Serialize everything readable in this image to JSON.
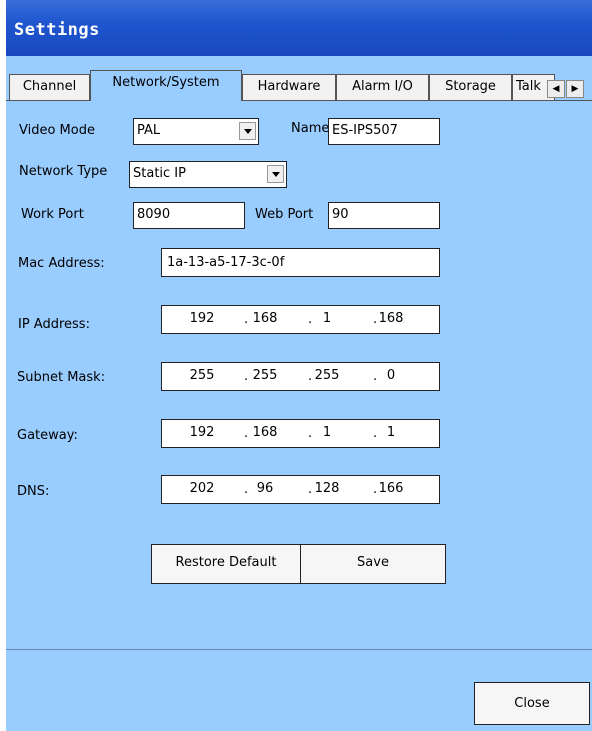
{
  "window": {
    "title": "Settings"
  },
  "tabs": [
    {
      "label": "Channel"
    },
    {
      "label": "Network/System"
    },
    {
      "label": "Hardware"
    },
    {
      "label": "Alarm I/O"
    },
    {
      "label": "Storage"
    },
    {
      "label": "Talk"
    }
  ],
  "form": {
    "video_mode": {
      "label": "Video Mode",
      "value": "PAL"
    },
    "name": {
      "label": "Name",
      "value": "ES-IPS507"
    },
    "network_type": {
      "label": "Network Type",
      "value": "Static IP"
    },
    "work_port": {
      "label": "Work Port",
      "value": "8090"
    },
    "web_port": {
      "label": "Web Port",
      "value": "90"
    },
    "mac_address": {
      "label": "Mac Address:",
      "value": "1a-13-a5-17-3c-0f"
    },
    "ip_address": {
      "label": "IP Address:",
      "octets": [
        "192",
        "168",
        "1",
        "168"
      ]
    },
    "subnet_mask": {
      "label": "Subnet Mask:",
      "octets": [
        "255",
        "255",
        "255",
        "0"
      ]
    },
    "gateway": {
      "label": "Gateway:",
      "octets": [
        "192",
        "168",
        "1",
        "1"
      ]
    },
    "dns": {
      "label": "DNS:",
      "octets": [
        "202",
        "96",
        "128",
        "166"
      ]
    }
  },
  "buttons": {
    "restore_default": "Restore Default",
    "save": "Save",
    "close": "Close"
  },
  "ip_separator": ".",
  "colors": {
    "title_bar": "#1f56cf",
    "panel_background": "#99ccff"
  }
}
